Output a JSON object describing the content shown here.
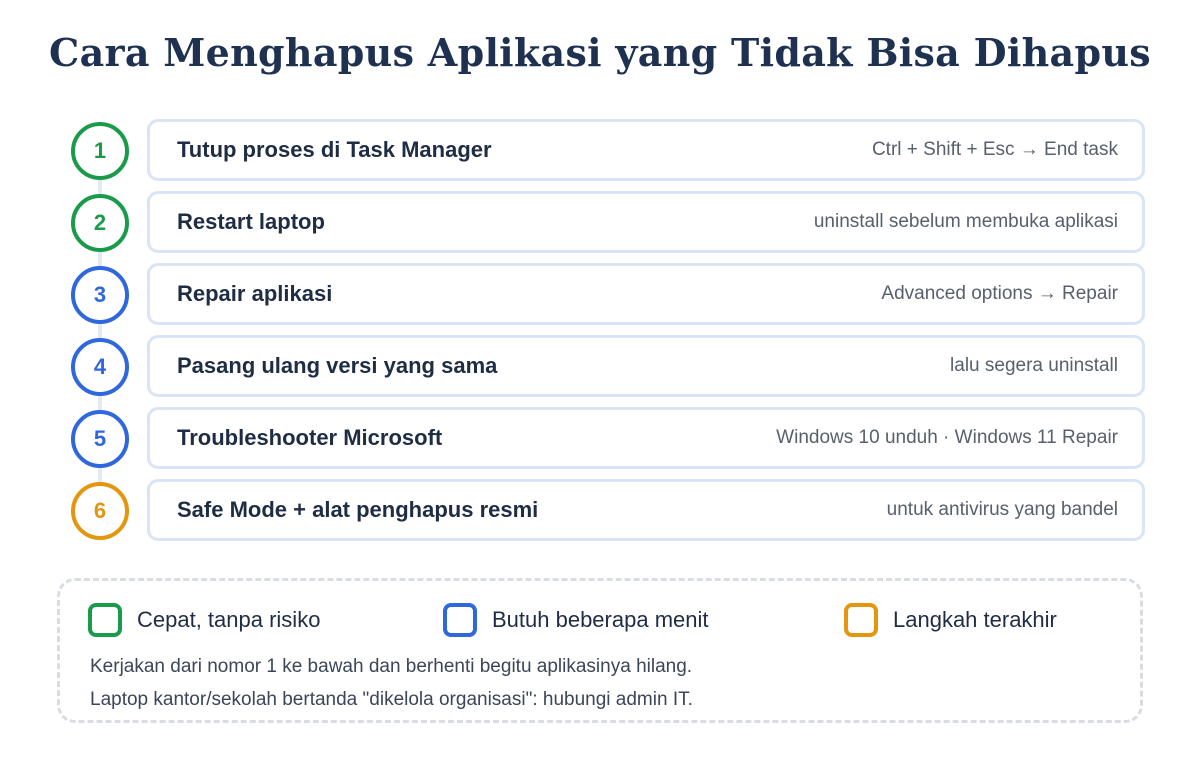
{
  "title": "Cara Menghapus Aplikasi yang Tidak Bisa Dihapus",
  "colors": {
    "green": "#1a9b4a",
    "blue": "#2f67dd",
    "orange": "#e4960f"
  },
  "steps": [
    {
      "number": "1",
      "title": "Tutup proses di Task Manager",
      "hint": "Ctrl + Shift + Esc → End task",
      "level": "green"
    },
    {
      "number": "2",
      "title": "Restart laptop",
      "hint": "uninstall sebelum membuka aplikasi",
      "level": "green"
    },
    {
      "number": "3",
      "title": "Repair aplikasi",
      "hint": "Advanced options → Repair",
      "level": "blue"
    },
    {
      "number": "4",
      "title": "Pasang ulang versi yang sama",
      "hint": "lalu segera uninstall",
      "level": "blue"
    },
    {
      "number": "5",
      "title": "Troubleshooter Microsoft",
      "hint": "Windows 10 unduh · Windows 11 Repair",
      "level": "blue"
    },
    {
      "number": "6",
      "title": "Safe Mode + alat penghapus resmi",
      "hint": "untuk antivirus yang bandel",
      "level": "orange"
    }
  ],
  "legend": [
    {
      "label": "Cepat, tanpa risiko",
      "color": "green"
    },
    {
      "label": "Butuh beberapa menit",
      "color": "blue"
    },
    {
      "label": "Langkah terakhir",
      "color": "orange"
    }
  ],
  "notes": [
    "Kerjakan dari nomor 1 ke bawah dan berhenti begitu aplikasinya hilang.",
    "Laptop kantor/sekolah bertanda \"dikelola organisasi\": hubungi admin IT."
  ]
}
